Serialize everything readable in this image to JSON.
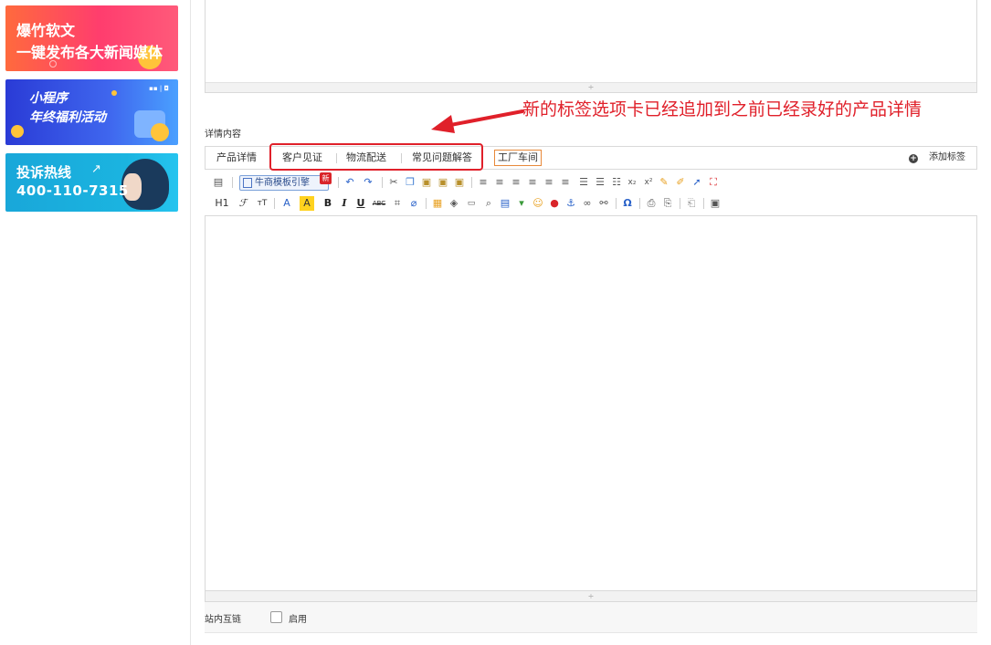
{
  "ads": [
    {
      "line1": "爆竹软文",
      "line2": "一键发布各大新闻媒体"
    },
    {
      "line1": "小程序",
      "line2": "年终福利活动"
    },
    {
      "line1": "投诉热线",
      "line2": "400-110-7315"
    }
  ],
  "editor": {
    "section_label": "详情内容",
    "resize_glyph": "÷",
    "tabs": [
      {
        "label": "产品详情"
      },
      {
        "label": "客户见证"
      },
      {
        "label": "物流配送"
      },
      {
        "label": "常见问题解答"
      },
      {
        "label": "工厂车间"
      }
    ],
    "add_tag_plus": "+",
    "add_tag_label": "添加标签",
    "template_button_label": "牛商模板引擎",
    "new_badge": "新",
    "heading_label": "H1",
    "toolbar_text": {
      "bold": "B",
      "italic": "I",
      "underline": "U",
      "strike": "ABC",
      "omega": "Ω",
      "font_size": "тT",
      "font_color": "A",
      "bg_color": "A",
      "sub": "x₂",
      "sup": "x²"
    }
  },
  "footer": {
    "label": "站内互链",
    "checkbox_label": "启用"
  },
  "annotation": {
    "text": "新的标签选项卡已经追加到之前已经录好的产品详情",
    "color": "#e0202a"
  },
  "colors": {
    "accent_red": "#e0202a",
    "tab_highlight_border": "#e8893a"
  }
}
